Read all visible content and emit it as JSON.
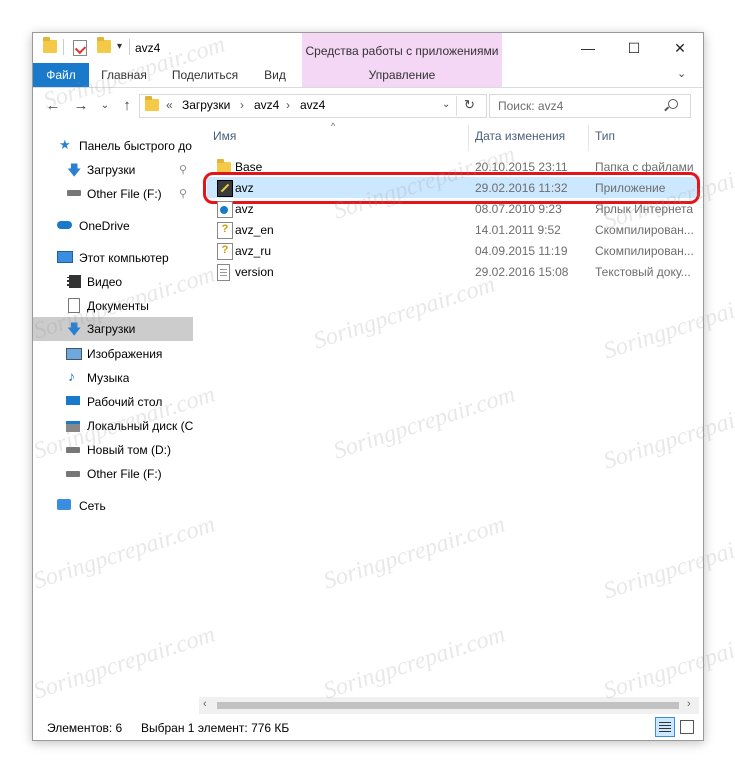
{
  "titlebar": {
    "path_title": "avz4",
    "contextual_tab": "Средства работы с приложениями",
    "minimize": "—",
    "maximize": "☐",
    "close": "✕"
  },
  "ribbon": {
    "tabs": [
      "Файл",
      "Главная",
      "Поделиться",
      "Вид",
      "Управление"
    ]
  },
  "address": {
    "prefix": "«",
    "crumbs": [
      "Загрузки",
      "avz4",
      "avz4"
    ],
    "separator": "›"
  },
  "search": {
    "placeholder": "Поиск: avz4"
  },
  "sidebar": {
    "items": [
      {
        "label": "Панель быстрого до",
        "icon": "star-icon"
      },
      {
        "label": "Загрузки",
        "icon": "download-icon",
        "pinned": true
      },
      {
        "label": "Other File (F:)",
        "icon": "drive-icon",
        "pinned": true
      },
      {
        "label": "OneDrive",
        "icon": "cloud-icon"
      },
      {
        "label": "Этот компьютер",
        "icon": "computer-icon"
      },
      {
        "label": "Видео",
        "icon": "video-icon"
      },
      {
        "label": "Документы",
        "icon": "document-icon"
      },
      {
        "label": "Загрузки",
        "icon": "download-icon",
        "selected": true
      },
      {
        "label": "Изображения",
        "icon": "image-icon"
      },
      {
        "label": "Музыка",
        "icon": "music-icon"
      },
      {
        "label": "Рабочий стол",
        "icon": "desktop-icon"
      },
      {
        "label": "Локальный диск (C",
        "icon": "windows-drive-icon"
      },
      {
        "label": "Новый том (D:)",
        "icon": "drive-icon"
      },
      {
        "label": "Other File (F:)",
        "icon": "drive-icon"
      },
      {
        "label": "Сеть",
        "icon": "network-icon"
      }
    ]
  },
  "columns": {
    "name": "Имя",
    "date": "Дата изменения",
    "type": "Тип"
  },
  "files": [
    {
      "name": "Base",
      "date": "20.10.2015 23:11",
      "type": "Папка с файлами",
      "icon": "folder-icon"
    },
    {
      "name": "avz",
      "date": "29.02.2016 11:32",
      "type": "Приложение",
      "icon": "application-icon",
      "selected": true
    },
    {
      "name": "avz",
      "date": "08.07.2010 9:23",
      "type": "Ярлык Интернета",
      "icon": "internet-shortcut-icon"
    },
    {
      "name": "avz_en",
      "date": "14.01.2011 9:52",
      "type": "Скомпилирован...",
      "icon": "help-file-icon"
    },
    {
      "name": "avz_ru",
      "date": "04.09.2015 11:19",
      "type": "Скомпилирован...",
      "icon": "help-file-icon"
    },
    {
      "name": "version",
      "date": "29.02.2016 15:08",
      "type": "Текстовый доку...",
      "icon": "text-file-icon"
    }
  ],
  "status": {
    "count": "Элементов: 6",
    "selection": "Выбран 1 элемент: 776 КБ"
  },
  "watermark": "Soringpcrepair.com",
  "colors": {
    "accent": "#1979ca",
    "contextual": "#f3d7f4",
    "selection": "#cce8ff",
    "highlight_ring": "#e5141b"
  }
}
